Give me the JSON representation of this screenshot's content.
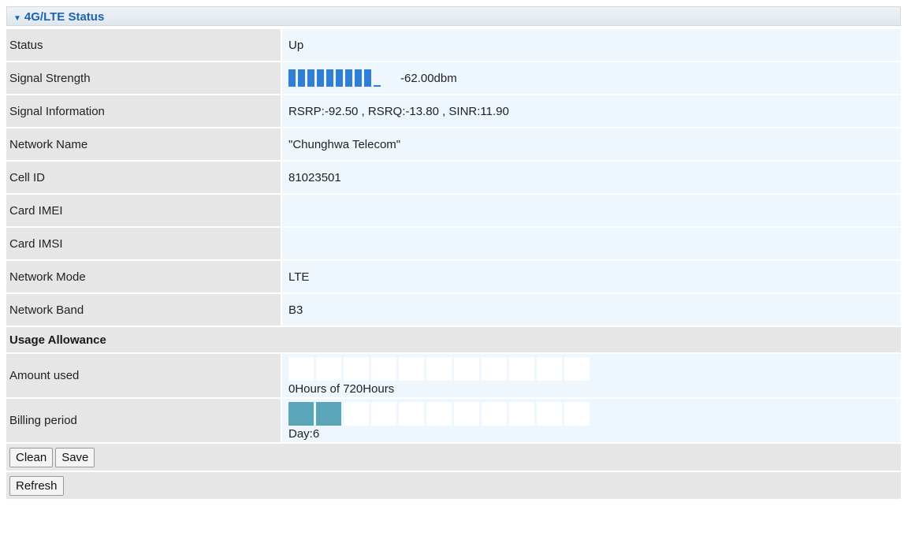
{
  "header": {
    "title": "4G/LTE Status"
  },
  "rows": [
    {
      "label": "Status",
      "value": "Up"
    },
    {
      "label": "Signal Strength",
      "value": "-62.00dbm",
      "bars_total": 10,
      "bars_filled": 9
    },
    {
      "label": "Signal Information",
      "value": "RSRP:-92.50 , RSRQ:-13.80 , SINR:11.90"
    },
    {
      "label": "Network Name",
      "value": "\"Chunghwa Telecom\""
    },
    {
      "label": "Cell ID",
      "value": "81023501"
    },
    {
      "label": "Card IMEI",
      "value": ""
    },
    {
      "label": "Card IMSI",
      "value": ""
    },
    {
      "label": "Network Mode",
      "value": "LTE"
    },
    {
      "label": "Network Band",
      "value": "B3"
    }
  ],
  "usage": {
    "section_title": "Usage Allowance",
    "amount_used": {
      "label": "Amount used",
      "text": "0Hours of 720Hours",
      "cells_total": 11,
      "cells_filled": 0
    },
    "billing_period": {
      "label": "Billing period",
      "text": "Day:6",
      "cells_total": 11,
      "cells_filled": 2
    }
  },
  "buttons": {
    "clean": "Clean",
    "save": "Save",
    "refresh": "Refresh"
  },
  "colors": {
    "accent": "#2f7fd8",
    "meter_fill": "#5aa5b8",
    "header_text": "#1c63b0"
  }
}
